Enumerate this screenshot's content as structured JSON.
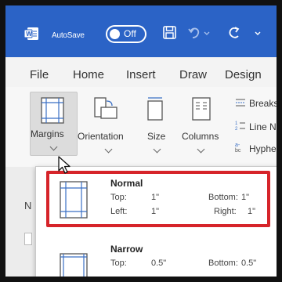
{
  "titlebar": {
    "autosave_label": "AutoSave",
    "autosave_state": "Off"
  },
  "menu": {
    "items": [
      "File",
      "Home",
      "Insert",
      "Draw",
      "Design"
    ]
  },
  "ribbon": {
    "margins": "Margins",
    "orientation": "Orientation",
    "size": "Size",
    "columns": "Columns",
    "breaks": "Breaks",
    "line_numbers": "Line N",
    "hyphenation": "Hyphe"
  },
  "document": {
    "left_glyph": "N"
  },
  "margins_menu": {
    "presets": [
      {
        "name": "Normal",
        "top_label": "Top:",
        "top": "1\"",
        "bottom_label": "Bottom:",
        "bottom": "1\"",
        "left_label": "Left:",
        "left": "1\"",
        "right_label": "Right:",
        "right": "1\""
      },
      {
        "name": "Narrow",
        "top_label": "Top:",
        "top": "0.5\"",
        "bottom_label": "Bottom:",
        "bottom": "0.5\""
      }
    ]
  },
  "colors": {
    "titlebar": "#2b63c6",
    "highlight": "#d6242a"
  }
}
